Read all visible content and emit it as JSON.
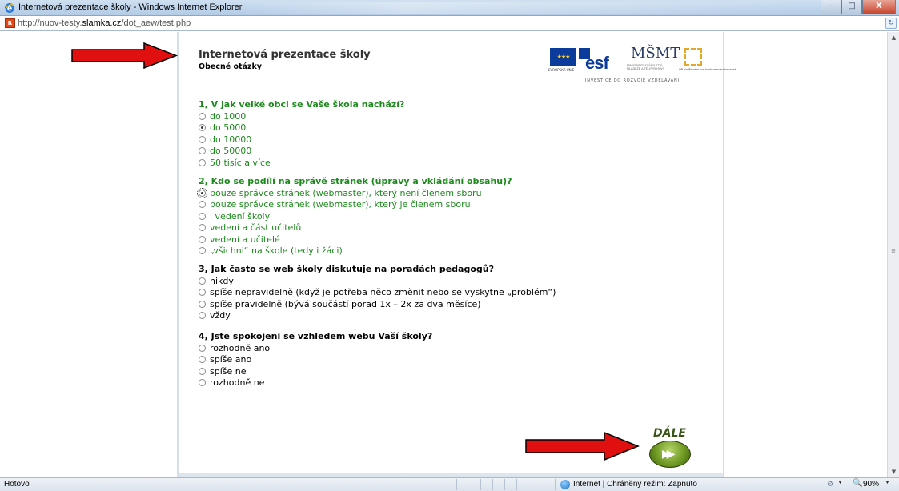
{
  "window": {
    "title": "Internetová prezentace školy - Windows Internet Explorer",
    "min_label": "–",
    "max_label": "□",
    "close_label": "X"
  },
  "address": {
    "url_prefix": "http://nuov-testy.",
    "url_domain": "slamka.cz",
    "url_path": "/dot_aew/test.php"
  },
  "page": {
    "title": "Internetová prezentace školy",
    "subtitle": "Obecné otázky",
    "logos": {
      "eu_caption": "EVROPSKÁ UNIE",
      "esf": "esf",
      "msmt": "MŠMT",
      "msmt_caption": "MINISTERSTVO ŠKOLSTVÍ, MLÁDEŽE A TĚLOVÝCHOVY",
      "op_caption": "OP Vzdělávání pro konkurenceschopnost",
      "invest_text": "INVESTICE DO ROZVOJE VZDĚLÁVÁNÍ"
    },
    "questions": [
      {
        "text": "1, V jak velké obci se Vaše škola nachází?",
        "color": "#1d8a1d",
        "options": [
          {
            "label": "do 1000",
            "checked": false
          },
          {
            "label": "do 5000",
            "checked": true
          },
          {
            "label": "do 10000",
            "checked": false
          },
          {
            "label": "do 50000",
            "checked": false
          },
          {
            "label": "50 tisíc a více",
            "checked": false
          }
        ]
      },
      {
        "text": "2, Kdo se podílí na správě stránek (úpravy a vkládání obsahu)?",
        "color": "#1d8a1d",
        "options": [
          {
            "label": "pouze správce stránek (webmaster), který není členem sboru",
            "checked": true
          },
          {
            "label": "pouze správce stránek (webmaster), který je členem sboru",
            "checked": false
          },
          {
            "label": "i vedení školy",
            "checked": false
          },
          {
            "label": "vedení a část učitelů",
            "checked": false
          },
          {
            "label": "vedení a učitelé",
            "checked": false
          },
          {
            "label": "„všichni“ na škole (tedy i žáci)",
            "checked": false
          }
        ]
      },
      {
        "text": "3, Jak často se web školy diskutuje na poradách pedagogů?",
        "color": "#000000",
        "options": [
          {
            "label": "nikdy",
            "checked": false
          },
          {
            "label": "spíše nepravidelně (když je potřeba něco změnit nebo se vyskytne „problém“)",
            "checked": false
          },
          {
            "label": "spíše pravidelně (bývá součástí porad 1x – 2x za dva měsíce)",
            "checked": false
          },
          {
            "label": "vždy",
            "checked": false
          }
        ]
      },
      {
        "text": "4, Jste spokojeni se vzhledem webu Vaší školy?",
        "color": "#000000",
        "options": [
          {
            "label": "rozhodně ano",
            "checked": false
          },
          {
            "label": "spíše ano",
            "checked": false
          },
          {
            "label": "spíše ne",
            "checked": false
          },
          {
            "label": "rozhodně ne",
            "checked": false
          }
        ]
      }
    ],
    "next_label": "DÁLE"
  },
  "status": {
    "text": "Hotovo",
    "zone": "Internet | Chráněný režim: Zapnuto",
    "zoom": "90%"
  },
  "colors": {
    "question_green": "#1d8a1d",
    "arrow_red": "#e01010",
    "next_green": "#6f9a23"
  },
  "icons": [
    "ie-icon",
    "site-icon",
    "refresh-icon",
    "red-arrow-icon",
    "globe-icon",
    "zoom-icon",
    "next-arrow-icon"
  ]
}
